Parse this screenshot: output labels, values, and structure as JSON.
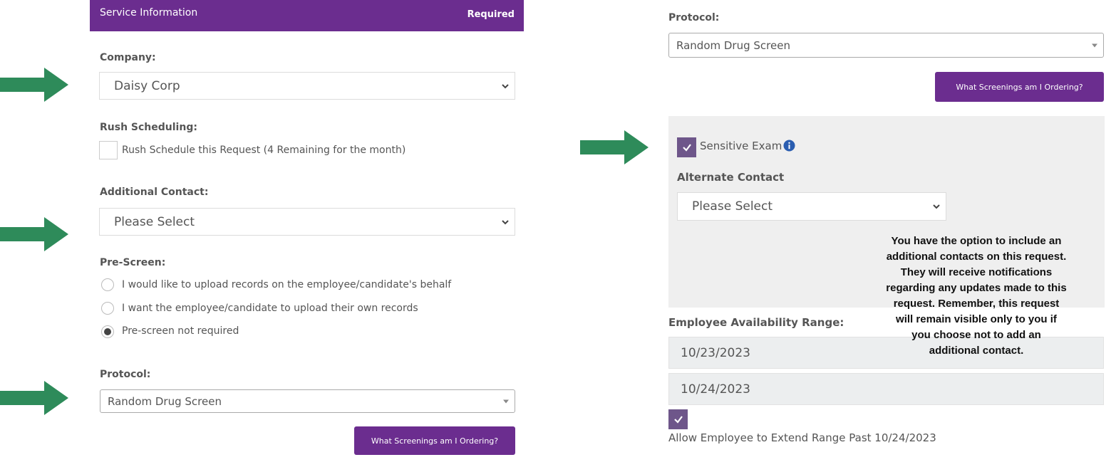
{
  "colors": {
    "accent": "#6b2d8f",
    "arrow": "#2e8b5a",
    "checkbox": "#6e568a",
    "info": "#2a5db0"
  },
  "header": {
    "title": "Service Information",
    "required": "Required"
  },
  "company": {
    "label": "Company:",
    "value": "Daisy Corp"
  },
  "rush": {
    "label": "Rush Scheduling:",
    "option": "Rush Schedule this Request (4 Remaining for the month)"
  },
  "additional_contact": {
    "label": "Additional Contact:",
    "value": "Please Select"
  },
  "prescreen": {
    "label": "Pre-Screen:",
    "options": [
      "I would like to upload records on the employee/candidate's behalf",
      "I want the employee/candidate to upload their own records",
      "Pre-screen not required"
    ],
    "selected": 2
  },
  "protocol_left": {
    "label": "Protocol:",
    "value": "Random Drug Screen",
    "button": "What Screenings am I Ordering?"
  },
  "protocol_right": {
    "label": "Protocol:",
    "value": "Random Drug Screen",
    "button": "What Screenings am I Ordering?"
  },
  "sensitive": {
    "label": "Sensitive Exam",
    "checked": true,
    "info_icon": "info-icon"
  },
  "alternate_contact": {
    "label": "Alternate Contact",
    "value": "Please Select"
  },
  "note": "You have the option to include an additional contacts on  this request. They will receive notifications regarding any updates made to this request. Remember, this request will remain visible only to you if you choose not to add an additional contact.",
  "availability": {
    "label": "Employee Availability Range:",
    "start": "10/23/2023",
    "end": "10/24/2023"
  },
  "extend": {
    "label": "Allow Employee to Extend Range Past 10/24/2023",
    "checked": true
  }
}
